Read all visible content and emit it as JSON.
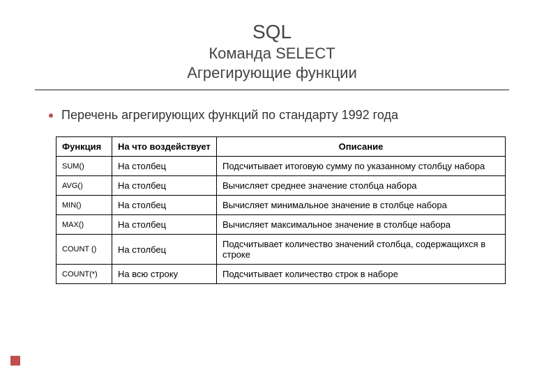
{
  "header": {
    "title_main": "SQL",
    "title_sub1": "Команда SELECT",
    "title_sub2": "Агрегирующие функции"
  },
  "bullet": {
    "text": "Перечень агрегирующих функций по стандарту 1992 года"
  },
  "table": {
    "headers": {
      "func": "Функция",
      "target": "На что воздействует",
      "desc": "Описание"
    },
    "rows": [
      {
        "func": "SUM()",
        "target": "На столбец",
        "desc": "Подсчитывает итоговую сумму по указанному столбцу набора"
      },
      {
        "func": "AVG()",
        "target": "На столбец",
        "desc": "Вычисляет среднее значение столбца набора"
      },
      {
        "func": "MIN()",
        "target": "На столбец",
        "desc": "Вычисляет минимальное значение в столбце набора"
      },
      {
        "func": "MAX()",
        "target": "На столбец",
        "desc": "Вычисляет максимальное значение в столбце набора"
      },
      {
        "func": "COUNT ()",
        "target": "На столбец",
        "desc": "Подсчитывает количество значений столбца, содержащихся в строке"
      },
      {
        "func": "COUNT(*)",
        "target": "На всю строку",
        "desc": "Подсчитывает количество строк в наборе"
      }
    ]
  }
}
